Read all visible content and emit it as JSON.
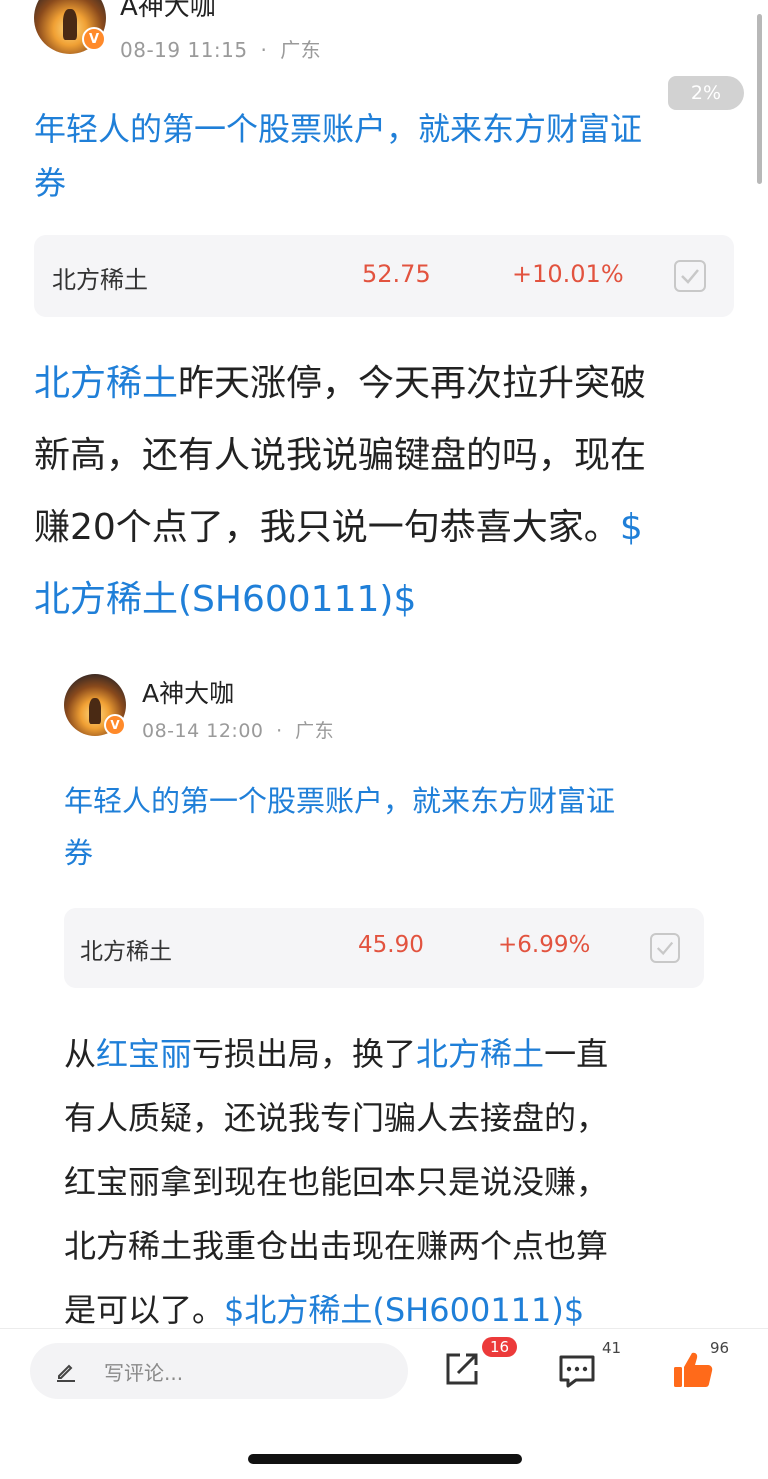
{
  "main_post": {
    "author": "A神大咖",
    "date": "08-19 11:15",
    "separator": "·",
    "location": "广东",
    "promo_line1": "年轻人的第一个股票账户，就来东方财富证",
    "promo_line2": "券",
    "quote": {
      "name": "北方稀土",
      "price": "52.75",
      "change": "+10.01%"
    },
    "lines": [
      {
        "parts": [
          {
            "t": "北方稀土",
            "link": true
          },
          {
            "t": "昨天涨停，今天再次拉升突破",
            "link": false
          }
        ]
      },
      {
        "parts": [
          {
            "t": "新高，还有人说我说骗键盘的吗，现在",
            "link": false
          }
        ]
      },
      {
        "parts": [
          {
            "t": "赚20个点了，我只说一句恭喜大家。",
            "link": false
          },
          {
            "t": "$",
            "link": true
          }
        ]
      },
      {
        "parts": [
          {
            "t": "北方稀土(SH600111)$",
            "link": true
          }
        ]
      }
    ]
  },
  "quoted_post": {
    "author": "A神大咖",
    "date": "08-14 12:00",
    "separator": "·",
    "location": "广东",
    "promo_line1": "年轻人的第一个股票账户，就来东方财富证",
    "promo_line2": "券",
    "quote": {
      "name": "北方稀土",
      "price": "45.90",
      "change": "+6.99%"
    },
    "lines": [
      {
        "parts": [
          {
            "t": "从",
            "link": false
          },
          {
            "t": "红宝丽",
            "link": true
          },
          {
            "t": "亏损出局，换了",
            "link": false
          },
          {
            "t": "北方稀土",
            "link": true
          },
          {
            "t": "一直",
            "link": false
          }
        ]
      },
      {
        "parts": [
          {
            "t": "有人质疑，还说我专门骗人去接盘的，",
            "link": false
          }
        ]
      },
      {
        "parts": [
          {
            "t": "红宝丽拿到现在也能回本只是说没赚，",
            "link": false
          }
        ]
      },
      {
        "parts": [
          {
            "t": "北方稀土我重仓出击现在赚两个点也算",
            "link": false
          }
        ]
      },
      {
        "parts": [
          {
            "t": "是可以了。",
            "link": false
          },
          {
            "t": "$北方稀土(SH600111)$",
            "link": true
          }
        ]
      }
    ]
  },
  "scroll_progress": "2%",
  "bottom_bar": {
    "comment_placeholder": "写评论...",
    "share_count": "16",
    "comment_count": "41",
    "like_count": "96"
  },
  "colors": {
    "link": "#1f7fd8",
    "up": "#e2533f",
    "like": "#ff6a1a",
    "badge": "#ec3a3a"
  }
}
